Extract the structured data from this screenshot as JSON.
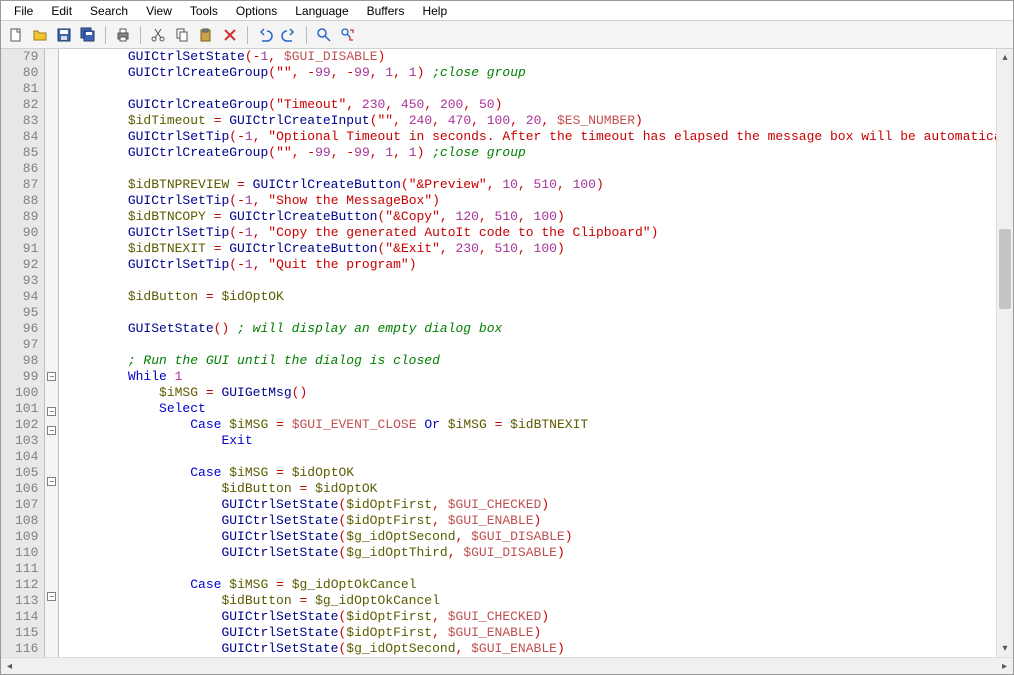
{
  "menu": [
    "File",
    "Edit",
    "Search",
    "View",
    "Tools",
    "Options",
    "Language",
    "Buffers",
    "Help"
  ],
  "toolbar_icons": [
    "new-file-icon",
    "open-file-icon",
    "save-file-icon",
    "save-all-icon",
    "|",
    "print-icon",
    "|",
    "cut-icon",
    "copy-icon",
    "paste-icon",
    "delete-icon",
    "|",
    "undo-icon",
    "redo-icon",
    "|",
    "find-icon",
    "find-replace-icon"
  ],
  "first_line_no": 79,
  "fold_marks": {
    "99": "-",
    "101": "-",
    "102": "-",
    "105": "-",
    "112": "-"
  },
  "code_lines": [
    [
      [
        "fn",
        "GUICtrlSetState"
      ],
      [
        "op",
        "("
      ],
      [
        "op",
        "-"
      ],
      [
        "num",
        "1"
      ],
      [
        "op",
        ", "
      ],
      [
        "mac",
        "$GUI_DISABLE"
      ],
      [
        "op",
        ")"
      ]
    ],
    [
      [
        "fn",
        "GUICtrlCreateGroup"
      ],
      [
        "op",
        "("
      ],
      [
        "str",
        "\"\""
      ],
      [
        "op",
        ", "
      ],
      [
        "op",
        "-"
      ],
      [
        "num",
        "99"
      ],
      [
        "op",
        ", "
      ],
      [
        "op",
        "-"
      ],
      [
        "num",
        "99"
      ],
      [
        "op",
        ", "
      ],
      [
        "num",
        "1"
      ],
      [
        "op",
        ", "
      ],
      [
        "num",
        "1"
      ],
      [
        "op",
        ") "
      ],
      [
        "com",
        ";close group"
      ]
    ],
    [],
    [
      [
        "fn",
        "GUICtrlCreateGroup"
      ],
      [
        "op",
        "("
      ],
      [
        "str",
        "\"Timeout\""
      ],
      [
        "op",
        ", "
      ],
      [
        "num",
        "230"
      ],
      [
        "op",
        ", "
      ],
      [
        "num",
        "450"
      ],
      [
        "op",
        ", "
      ],
      [
        "num",
        "200"
      ],
      [
        "op",
        ", "
      ],
      [
        "num",
        "50"
      ],
      [
        "op",
        ")"
      ]
    ],
    [
      [
        "var",
        "$idTimeout"
      ],
      [
        "op",
        " = "
      ],
      [
        "fn",
        "GUICtrlCreateInput"
      ],
      [
        "op",
        "("
      ],
      [
        "str",
        "\"\""
      ],
      [
        "op",
        ", "
      ],
      [
        "num",
        "240"
      ],
      [
        "op",
        ", "
      ],
      [
        "num",
        "470"
      ],
      [
        "op",
        ", "
      ],
      [
        "num",
        "100"
      ],
      [
        "op",
        ", "
      ],
      [
        "num",
        "20"
      ],
      [
        "op",
        ", "
      ],
      [
        "mac",
        "$ES_NUMBER"
      ],
      [
        "op",
        ")"
      ]
    ],
    [
      [
        "fn",
        "GUICtrlSetTip"
      ],
      [
        "op",
        "("
      ],
      [
        "op",
        "-"
      ],
      [
        "num",
        "1"
      ],
      [
        "op",
        ", "
      ],
      [
        "str",
        "\"Optional Timeout in seconds. After the timeout has elapsed the message box will be automatically closed.\""
      ],
      [
        "op",
        ")"
      ]
    ],
    [
      [
        "fn",
        "GUICtrlCreateGroup"
      ],
      [
        "op",
        "("
      ],
      [
        "str",
        "\"\""
      ],
      [
        "op",
        ", "
      ],
      [
        "op",
        "-"
      ],
      [
        "num",
        "99"
      ],
      [
        "op",
        ", "
      ],
      [
        "op",
        "-"
      ],
      [
        "num",
        "99"
      ],
      [
        "op",
        ", "
      ],
      [
        "num",
        "1"
      ],
      [
        "op",
        ", "
      ],
      [
        "num",
        "1"
      ],
      [
        "op",
        ") "
      ],
      [
        "com",
        ";close group"
      ]
    ],
    [],
    [
      [
        "var",
        "$idBTNPREVIEW"
      ],
      [
        "op",
        " = "
      ],
      [
        "fn",
        "GUICtrlCreateButton"
      ],
      [
        "op",
        "("
      ],
      [
        "str",
        "\"&Preview\""
      ],
      [
        "op",
        ", "
      ],
      [
        "num",
        "10"
      ],
      [
        "op",
        ", "
      ],
      [
        "num",
        "510"
      ],
      [
        "op",
        ", "
      ],
      [
        "num",
        "100"
      ],
      [
        "op",
        ")"
      ]
    ],
    [
      [
        "fn",
        "GUICtrlSetTip"
      ],
      [
        "op",
        "("
      ],
      [
        "op",
        "-"
      ],
      [
        "num",
        "1"
      ],
      [
        "op",
        ", "
      ],
      [
        "str",
        "\"Show the MessageBox\""
      ],
      [
        "op",
        ")"
      ]
    ],
    [
      [
        "var",
        "$idBTNCOPY"
      ],
      [
        "op",
        " = "
      ],
      [
        "fn",
        "GUICtrlCreateButton"
      ],
      [
        "op",
        "("
      ],
      [
        "str",
        "\"&Copy\""
      ],
      [
        "op",
        ", "
      ],
      [
        "num",
        "120"
      ],
      [
        "op",
        ", "
      ],
      [
        "num",
        "510"
      ],
      [
        "op",
        ", "
      ],
      [
        "num",
        "100"
      ],
      [
        "op",
        ")"
      ]
    ],
    [
      [
        "fn",
        "GUICtrlSetTip"
      ],
      [
        "op",
        "("
      ],
      [
        "op",
        "-"
      ],
      [
        "num",
        "1"
      ],
      [
        "op",
        ", "
      ],
      [
        "str",
        "\"Copy the generated AutoIt code to the Clipboard\""
      ],
      [
        "op",
        ")"
      ]
    ],
    [
      [
        "var",
        "$idBTNEXIT"
      ],
      [
        "op",
        " = "
      ],
      [
        "fn",
        "GUICtrlCreateButton"
      ],
      [
        "op",
        "("
      ],
      [
        "str",
        "\"&Exit\""
      ],
      [
        "op",
        ", "
      ],
      [
        "num",
        "230"
      ],
      [
        "op",
        ", "
      ],
      [
        "num",
        "510"
      ],
      [
        "op",
        ", "
      ],
      [
        "num",
        "100"
      ],
      [
        "op",
        ")"
      ]
    ],
    [
      [
        "fn",
        "GUICtrlSetTip"
      ],
      [
        "op",
        "("
      ],
      [
        "op",
        "-"
      ],
      [
        "num",
        "1"
      ],
      [
        "op",
        ", "
      ],
      [
        "str",
        "\"Quit the program\""
      ],
      [
        "op",
        ")"
      ]
    ],
    [],
    [
      [
        "var",
        "$idButton"
      ],
      [
        "op",
        " = "
      ],
      [
        "var",
        "$idOptOK"
      ]
    ],
    [],
    [
      [
        "fn",
        "GUISetState"
      ],
      [
        "op",
        "() "
      ],
      [
        "com",
        "; will display an empty dialog box"
      ]
    ],
    [],
    [
      [
        "com",
        "; Run the GUI until the dialog is closed"
      ]
    ],
    [
      [
        "kw",
        "While"
      ],
      [
        "txt",
        " "
      ],
      [
        "num",
        "1"
      ]
    ],
    [
      [
        "txt",
        "    "
      ],
      [
        "var",
        "$iMSG"
      ],
      [
        "op",
        " = "
      ],
      [
        "fn",
        "GUIGetMsg"
      ],
      [
        "op",
        "()"
      ]
    ],
    [
      [
        "txt",
        "    "
      ],
      [
        "kw",
        "Select"
      ]
    ],
    [
      [
        "txt",
        "        "
      ],
      [
        "kw",
        "Case"
      ],
      [
        "txt",
        " "
      ],
      [
        "var",
        "$iMSG"
      ],
      [
        "op",
        " = "
      ],
      [
        "mac",
        "$GUI_EVENT_CLOSE"
      ],
      [
        "txt",
        " "
      ],
      [
        "kw",
        "Or"
      ],
      [
        "txt",
        " "
      ],
      [
        "var",
        "$iMSG"
      ],
      [
        "op",
        " = "
      ],
      [
        "var",
        "$idBTNEXIT"
      ]
    ],
    [
      [
        "txt",
        "            "
      ],
      [
        "kw",
        "Exit"
      ]
    ],
    [],
    [
      [
        "txt",
        "        "
      ],
      [
        "kw",
        "Case"
      ],
      [
        "txt",
        " "
      ],
      [
        "var",
        "$iMSG"
      ],
      [
        "op",
        " = "
      ],
      [
        "var",
        "$idOptOK"
      ]
    ],
    [
      [
        "txt",
        "            "
      ],
      [
        "var",
        "$idButton"
      ],
      [
        "op",
        " = "
      ],
      [
        "var",
        "$idOptOK"
      ]
    ],
    [
      [
        "txt",
        "            "
      ],
      [
        "fn",
        "GUICtrlSetState"
      ],
      [
        "op",
        "("
      ],
      [
        "var",
        "$idOptFirst"
      ],
      [
        "op",
        ", "
      ],
      [
        "mac",
        "$GUI_CHECKED"
      ],
      [
        "op",
        ")"
      ]
    ],
    [
      [
        "txt",
        "            "
      ],
      [
        "fn",
        "GUICtrlSetState"
      ],
      [
        "op",
        "("
      ],
      [
        "var",
        "$idOptFirst"
      ],
      [
        "op",
        ", "
      ],
      [
        "mac",
        "$GUI_ENABLE"
      ],
      [
        "op",
        ")"
      ]
    ],
    [
      [
        "txt",
        "            "
      ],
      [
        "fn",
        "GUICtrlSetState"
      ],
      [
        "op",
        "("
      ],
      [
        "var",
        "$g_idOptSecond"
      ],
      [
        "op",
        ", "
      ],
      [
        "mac",
        "$GUI_DISABLE"
      ],
      [
        "op",
        ")"
      ]
    ],
    [
      [
        "txt",
        "            "
      ],
      [
        "fn",
        "GUICtrlSetState"
      ],
      [
        "op",
        "("
      ],
      [
        "var",
        "$g_idOptThird"
      ],
      [
        "op",
        ", "
      ],
      [
        "mac",
        "$GUI_DISABLE"
      ],
      [
        "op",
        ")"
      ]
    ],
    [],
    [
      [
        "txt",
        "        "
      ],
      [
        "kw",
        "Case"
      ],
      [
        "txt",
        " "
      ],
      [
        "var",
        "$iMSG"
      ],
      [
        "op",
        " = "
      ],
      [
        "var",
        "$g_idOptOkCancel"
      ]
    ],
    [
      [
        "txt",
        "            "
      ],
      [
        "var",
        "$idButton"
      ],
      [
        "op",
        " = "
      ],
      [
        "var",
        "$g_idOptOkCancel"
      ]
    ],
    [
      [
        "txt",
        "            "
      ],
      [
        "fn",
        "GUICtrlSetState"
      ],
      [
        "op",
        "("
      ],
      [
        "var",
        "$idOptFirst"
      ],
      [
        "op",
        ", "
      ],
      [
        "mac",
        "$GUI_CHECKED"
      ],
      [
        "op",
        ")"
      ]
    ],
    [
      [
        "txt",
        "            "
      ],
      [
        "fn",
        "GUICtrlSetState"
      ],
      [
        "op",
        "("
      ],
      [
        "var",
        "$idOptFirst"
      ],
      [
        "op",
        ", "
      ],
      [
        "mac",
        "$GUI_ENABLE"
      ],
      [
        "op",
        ")"
      ]
    ],
    [
      [
        "txt",
        "            "
      ],
      [
        "fn",
        "GUICtrlSetState"
      ],
      [
        "op",
        "("
      ],
      [
        "var",
        "$g_idOptSecond"
      ],
      [
        "op",
        ", "
      ],
      [
        "mac",
        "$GUI_ENABLE"
      ],
      [
        "op",
        ")"
      ]
    ]
  ],
  "base_indent": "        "
}
